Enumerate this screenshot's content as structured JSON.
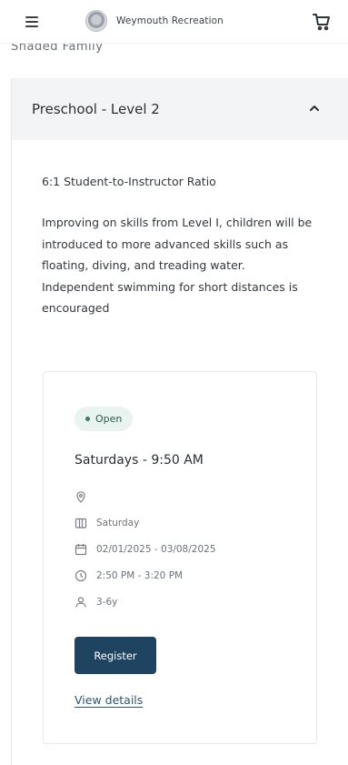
{
  "header": {
    "brand_name": "Weymouth Recreation",
    "menu_icon": "hamburger-menu-icon",
    "cart_icon": "shopping-cart-icon"
  },
  "previous_section": {
    "cut_off_label": "Shaded Family"
  },
  "accordion": {
    "title": "Preschool - Level 2",
    "expanded": true,
    "ratio": "6:1 Student-to-Instructor Ratio",
    "description": "Improving on skills from Level I, children will be introduced to more advanced skills such as floating, diving, and treading water. Independent swimming for short distances is encouraged"
  },
  "session": {
    "status": "Open",
    "title": "Saturdays - 9:50 AM",
    "location": "",
    "days": "Saturday",
    "dates": "02/01/2025 - 03/08/2025",
    "time": "2:50 PM - 3:20 PM",
    "ages": "3-6y",
    "register_label": "Register",
    "details_label": "View details"
  },
  "colors": {
    "primary": "#1f4462",
    "badge_bg": "#e9f3ef",
    "link": "#2c5676"
  }
}
